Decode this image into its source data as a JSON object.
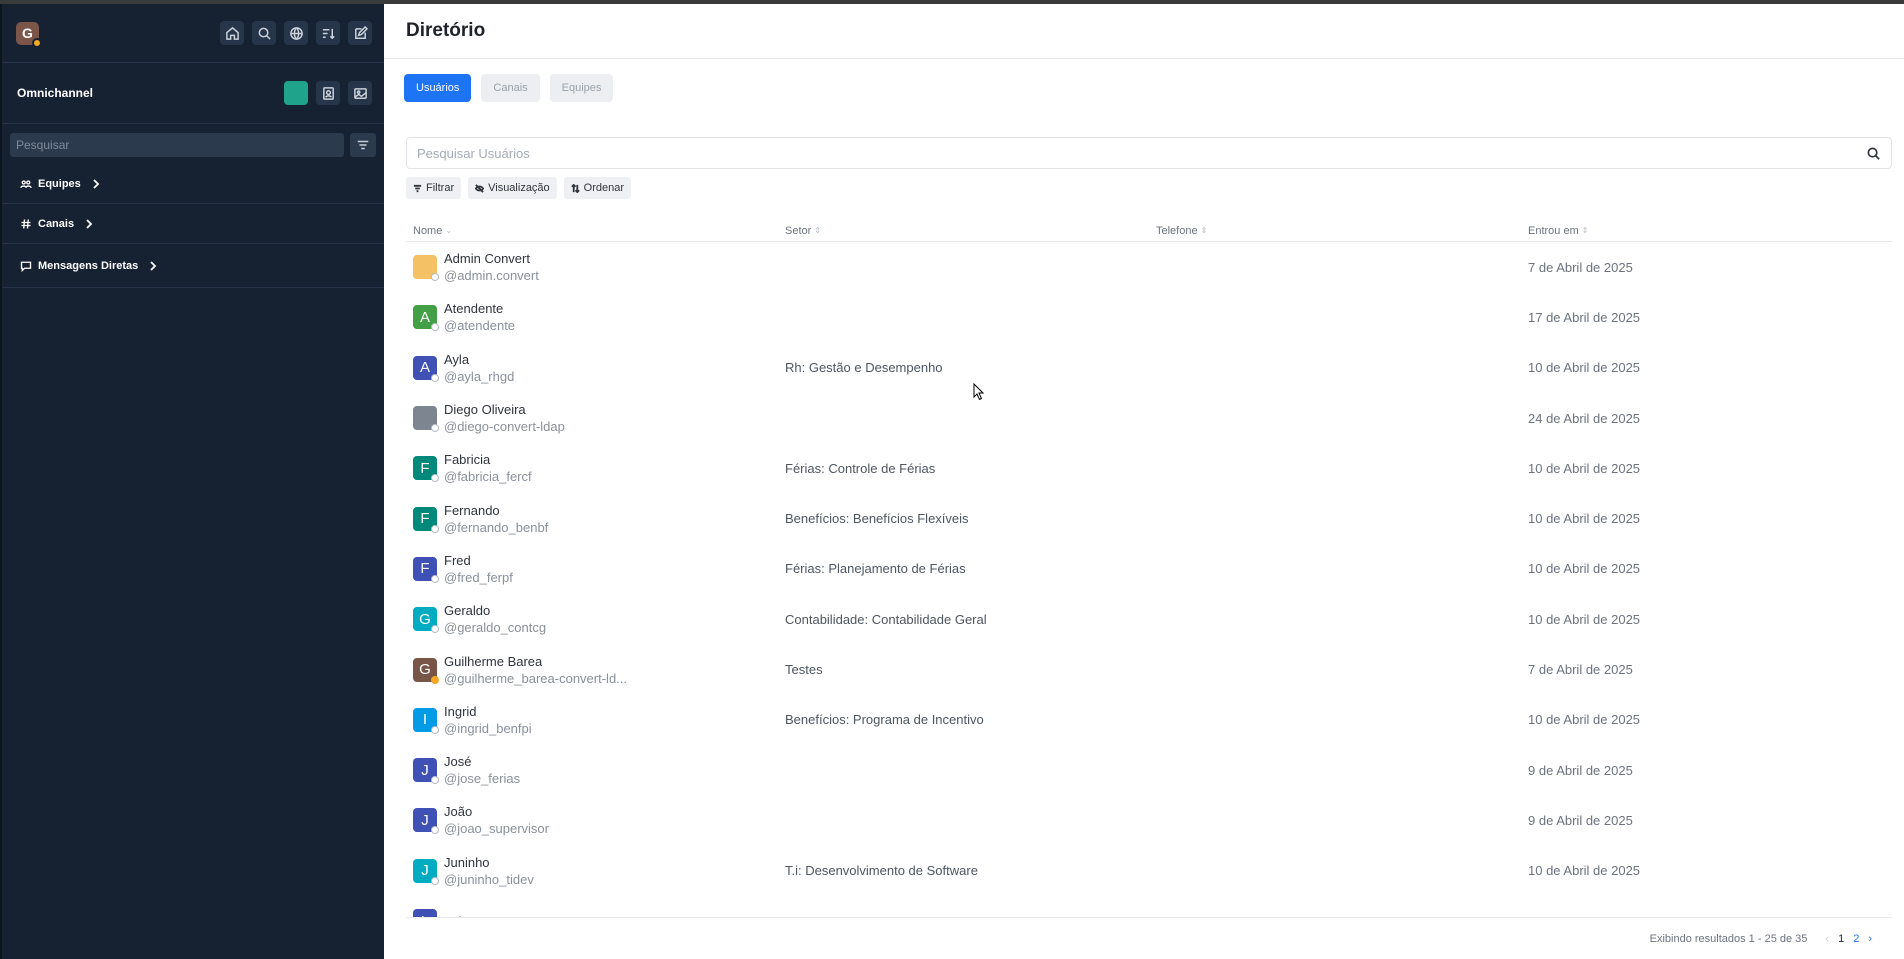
{
  "sidebar": {
    "workspace_initial": "G",
    "top_icons": [
      "home-icon",
      "search-icon",
      "globe-icon",
      "sort-icon",
      "edit-icon"
    ],
    "omnichannel_label": "Omnichannel",
    "search_placeholder": "Pesquisar",
    "groups": [
      {
        "label": "Equipes",
        "icon": "team-icon"
      },
      {
        "label": "Canais",
        "icon": "hash-icon"
      },
      {
        "label": "Mensagens Diretas",
        "icon": "message-icon"
      }
    ]
  },
  "main": {
    "title": "Diretório",
    "tabs": [
      {
        "label": "Usuários",
        "active": true
      },
      {
        "label": "Canais",
        "active": false
      },
      {
        "label": "Equipes",
        "active": false
      }
    ],
    "search_placeholder": "Pesquisar Usuários",
    "chips": [
      "Filtrar",
      "Visualização",
      "Ordenar"
    ],
    "columns": [
      "Nome",
      "Setor",
      "Telefone",
      "Entrou em"
    ],
    "rows": [
      {
        "initial": "",
        "color": "#f4c164",
        "name": "Admin Convert",
        "handle": "@admin.convert",
        "sector": "",
        "phone": "",
        "joined": "7 de Abril de 2025",
        "status": "offline"
      },
      {
        "initial": "A",
        "color": "#43a047",
        "name": "Atendente",
        "handle": "@atendente",
        "sector": "",
        "phone": "",
        "joined": "17 de Abril de 2025",
        "status": "offline"
      },
      {
        "initial": "A",
        "color": "#3f51b5",
        "name": "Ayla",
        "handle": "@ayla_rhgd",
        "sector": "Rh: Gestão e Desempenho",
        "phone": "",
        "joined": "10 de Abril de 2025",
        "status": "offline"
      },
      {
        "initial": "",
        "color": "#7d8590",
        "name": "Diego Oliveira",
        "handle": "@diego-convert-ldap",
        "sector": "",
        "phone": "",
        "joined": "24 de Abril de 2025",
        "status": "offline"
      },
      {
        "initial": "F",
        "color": "#00897b",
        "name": "Fabricia",
        "handle": "@fabricia_fercf",
        "sector": "Férias: Controle de Férias",
        "phone": "",
        "joined": "10 de Abril de 2025",
        "status": "offline"
      },
      {
        "initial": "F",
        "color": "#00897b",
        "name": "Fernando",
        "handle": "@fernando_benbf",
        "sector": "Benefícios: Benefícios Flexíveis",
        "phone": "",
        "joined": "10 de Abril de 2025",
        "status": "offline"
      },
      {
        "initial": "F",
        "color": "#3f51b5",
        "name": "Fred",
        "handle": "@fred_ferpf",
        "sector": "Férias: Planejamento de Férias",
        "phone": "",
        "joined": "10 de Abril de 2025",
        "status": "offline"
      },
      {
        "initial": "G",
        "color": "#00acc1",
        "name": "Geraldo",
        "handle": "@geraldo_contcg",
        "sector": "Contabilidade: Contabilidade Geral",
        "phone": "",
        "joined": "10 de Abril de 2025",
        "status": "offline"
      },
      {
        "initial": "G",
        "color": "#795548",
        "name": "Guilherme Barea",
        "handle": "@guilherme_barea-convert-ld...",
        "sector": "Testes",
        "phone": "",
        "joined": "7 de Abril de 2025",
        "status": "away"
      },
      {
        "initial": "I",
        "color": "#039be5",
        "name": "Ingrid",
        "handle": "@ingrid_benfpi",
        "sector": "Benefícios: Programa de Incentivo",
        "phone": "",
        "joined": "10 de Abril de 2025",
        "status": "offline"
      },
      {
        "initial": "J",
        "color": "#3f51b5",
        "name": "José",
        "handle": "@jose_ferias",
        "sector": "",
        "phone": "",
        "joined": "9 de Abril de 2025",
        "status": "offline"
      },
      {
        "initial": "J",
        "color": "#3f51b5",
        "name": "João",
        "handle": "@joao_supervisor",
        "sector": "",
        "phone": "",
        "joined": "9 de Abril de 2025",
        "status": "offline"
      },
      {
        "initial": "J",
        "color": "#00acc1",
        "name": "Juninho",
        "handle": "@juninho_tidev",
        "sector": "T.i: Desenvolvimento de Software",
        "phone": "",
        "joined": "10 de Abril de 2025",
        "status": "offline"
      },
      {
        "initial": "L",
        "color": "#3f51b5",
        "name": "Lola",
        "handle": "",
        "sector": "",
        "phone": "",
        "joined": "",
        "status": "offline"
      }
    ],
    "results_text": "Exibindo resultados 1 - 25 de 35",
    "pages": [
      "1",
      "2"
    ]
  }
}
